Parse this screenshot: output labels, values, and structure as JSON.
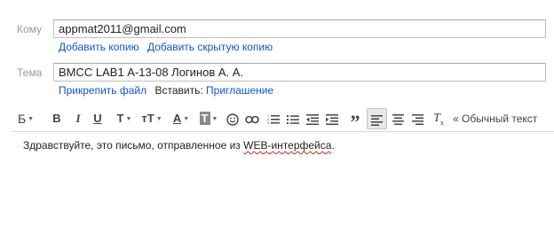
{
  "to": {
    "label": "Кому",
    "value": "appmat2011@gmail.com",
    "add_cc": "Добавить копию",
    "add_bcc": "Добавить скрытую копию"
  },
  "subject": {
    "label": "Тема",
    "value": "ВМСС LAB1 А-13-08 Логинов А. А.",
    "attach_file": "Прикрепить файл",
    "insert_label": "Вставить:",
    "invitation": "Приглашение"
  },
  "toolbar": {
    "font_family": "Б",
    "bold": "B",
    "italic": "I",
    "underline": "U",
    "font_size": "T",
    "text_size": "тT",
    "text_color": "A",
    "highlight": "T",
    "plain_text": "« Обычный текст"
  },
  "body": {
    "text_before": "Здравствуйте, это письмо, отправленное из ",
    "text_misspelled": "WEB-интерфейса",
    "text_after": "."
  },
  "colors": {
    "link": "#1155cc",
    "label": "#999999",
    "spellcheck": "#dd2222"
  }
}
